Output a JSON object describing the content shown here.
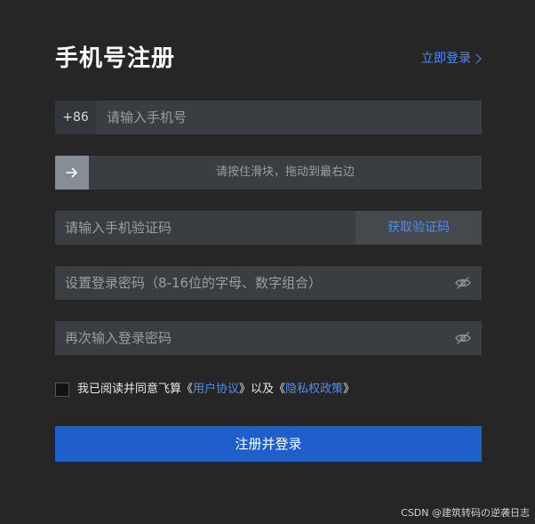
{
  "header": {
    "title": "手机号注册",
    "login_link": "立即登录"
  },
  "phone": {
    "prefix": "+86",
    "placeholder": "请输入手机号"
  },
  "slider": {
    "text": "请按住滑块，拖动到最右边"
  },
  "code": {
    "placeholder": "请输入手机验证码",
    "get_code_label": "获取验证码"
  },
  "password": {
    "placeholder": "设置登录密码（8-16位的字母、数字组合）"
  },
  "confirm_password": {
    "placeholder": "再次输入登录密码"
  },
  "agreement": {
    "prefix": "我已阅读并同意飞算《",
    "user_agreement": "用户协议",
    "middle": "》以及《",
    "privacy_policy": "隐私权政策",
    "suffix": "》"
  },
  "submit": {
    "label": "注册并登录"
  },
  "watermark": {
    "text": "CSDN @建筑转码の逆袭日志"
  },
  "icons": {
    "slider_handle": "arrow-right-icon",
    "password_toggle": "eye-slash-icon",
    "login_link": "chevron-right-icon"
  },
  "colors": {
    "background": "#262626",
    "field": "#3a3d41",
    "accent": "#4a8ef0",
    "primary_button": "#1f5fcc"
  }
}
